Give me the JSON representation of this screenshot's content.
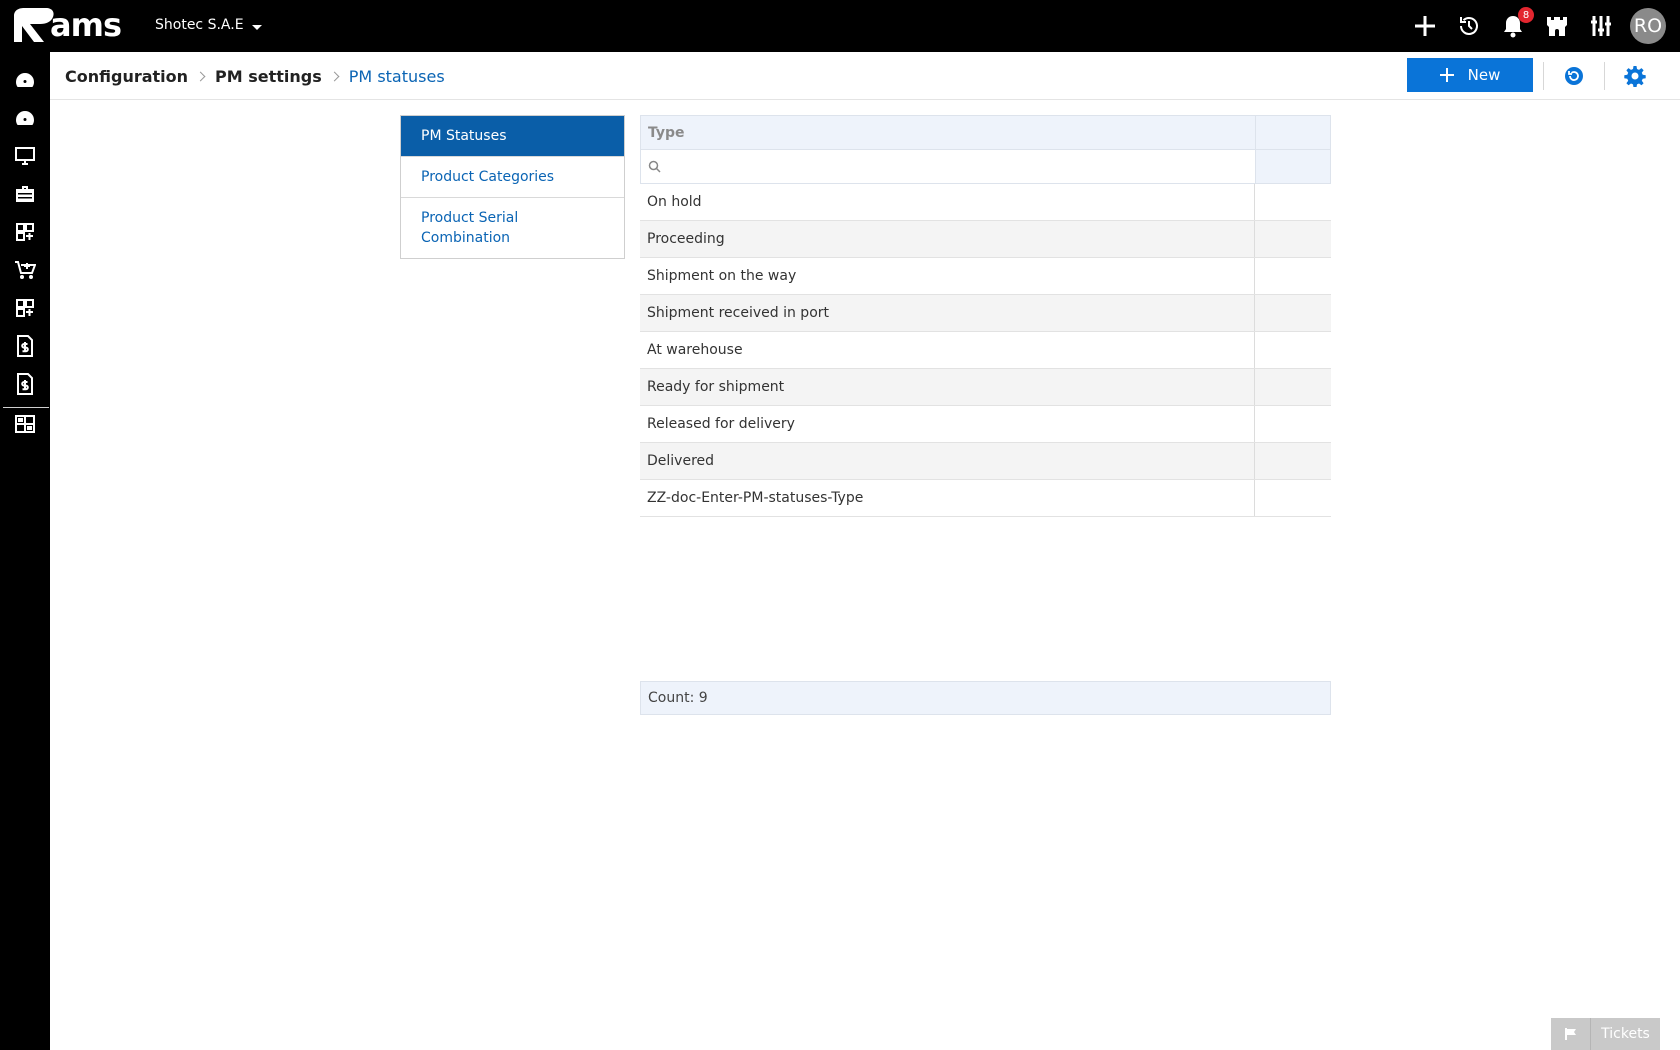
{
  "app": {
    "logo_text": "ams",
    "company": "Shotec S.A.E",
    "notification_count": "8",
    "user_initials": "RO"
  },
  "breadcrumb": [
    {
      "label": "Configuration"
    },
    {
      "label": "PM settings"
    },
    {
      "label": "PM statuses"
    }
  ],
  "toolbar": {
    "new_label": "New"
  },
  "leftnav": {
    "items": [
      {
        "label": "PM Statuses",
        "selected": true
      },
      {
        "label": "Product Categories",
        "selected": false
      },
      {
        "label": "Product Serial Combination",
        "selected": false
      }
    ]
  },
  "grid": {
    "columns": [
      "Type",
      ""
    ],
    "filter_value": "",
    "rows": [
      "On hold",
      "Proceeding",
      "Shipment on the way",
      "Shipment received in port",
      "At warehouse",
      "Ready for shipment",
      "Released for delivery",
      "Delivered",
      "ZZ-doc-Enter-PM-statuses-Type"
    ],
    "count_text": "Count: 9"
  },
  "tickets": {
    "label": "Tickets"
  },
  "colors": {
    "accent": "#0a74d8",
    "selected_nav": "#0a5ea8",
    "link": "#0a64b4",
    "badge": "#e3262f"
  }
}
